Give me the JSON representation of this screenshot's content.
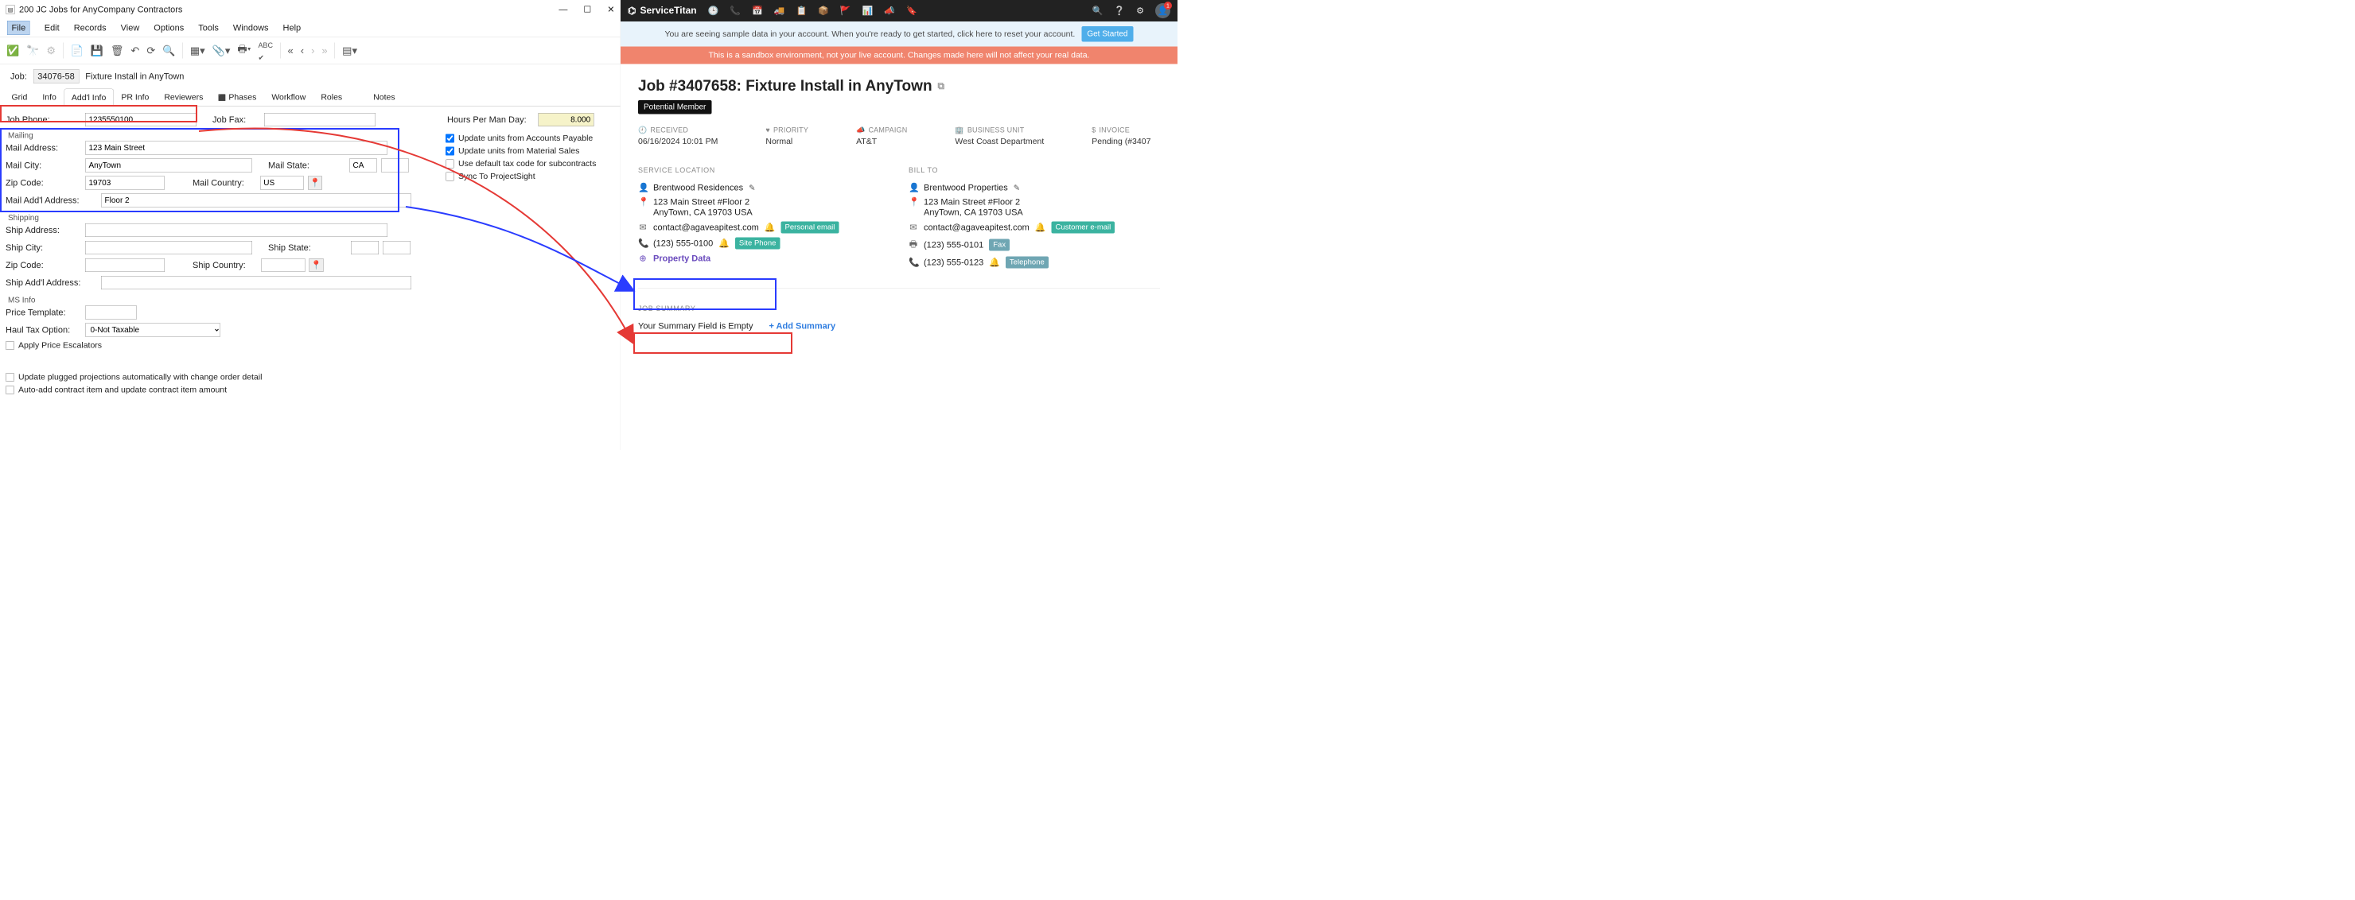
{
  "left": {
    "title": "200 JC Jobs for AnyCompany Contractors",
    "menu": [
      "File",
      "Edit",
      "Records",
      "View",
      "Options",
      "Tools",
      "Windows",
      "Help"
    ],
    "job_label": "Job:",
    "job_id": "34076-58",
    "job_desc": "Fixture Install in AnyTown",
    "tabs": [
      "Grid",
      "Info",
      "Add'l Info",
      "PR Info",
      "Reviewers",
      "Phases",
      "Workflow",
      "Roles",
      "Notes"
    ],
    "fields": {
      "job_phone_label": "Job Phone:",
      "job_phone": "1235550100",
      "job_fax_label": "Job Fax:",
      "job_fax": "",
      "hours_label": "Hours Per Man Day:",
      "hours": "8.000",
      "mailing_header": "Mailing",
      "mail_address_label": "Mail Address:",
      "mail_address": "123 Main Street",
      "mail_city_label": "Mail City:",
      "mail_city": "AnyTown",
      "mail_state_label": "Mail State:",
      "mail_state": "CA",
      "zip_label": "Zip Code:",
      "zip": "19703",
      "mail_country_label": "Mail Country:",
      "mail_country": "US",
      "mail_addl_label": "Mail Add'l Address:",
      "mail_addl": "Floor 2",
      "shipping_header": "Shipping",
      "ship_address_label": "Ship Address:",
      "ship_city_label": "Ship City:",
      "ship_state_label": "Ship State:",
      "ship_zip_label": "Zip Code:",
      "ship_country_label": "Ship Country:",
      "ship_addl_label": "Ship Add'l Address:",
      "ms_header": "MS Info",
      "price_template_label": "Price Template:",
      "haul_tax_label": "Haul Tax Option:",
      "haul_tax_value": "0-Not Taxable",
      "chk_escalators": "Apply Price Escalators",
      "chk_update_proj": "Update plugged projections automatically with change order detail",
      "chk_autoadd": "Auto-add contract item and update contract item amount",
      "chk_units_ap": "Update units from Accounts Payable",
      "chk_units_ms": "Update units from Material Sales",
      "chk_default_tax": "Use default tax code for subcontracts",
      "chk_sync": "Sync To ProjectSight"
    }
  },
  "right": {
    "brand": "ServiceTitan",
    "banner1": "You are seeing sample data in your account. When you're ready to get started, click here to reset your account.",
    "banner1_btn": "Get Started",
    "banner2": "This is a sandbox environment, not your live account. Changes made here will not affect your real data.",
    "title": "Job #3407658: Fixture Install in AnyTown",
    "badge": "Potential Member",
    "meta": {
      "received_h": "RECEIVED",
      "received": "06/16/2024 10:01 PM",
      "priority_h": "PRIORITY",
      "priority": "Normal",
      "campaign_h": "CAMPAIGN",
      "campaign": "AT&T",
      "bu_h": "BUSINESS UNIT",
      "bu": "West Coast Department",
      "invoice_h": "INVOICE",
      "invoice": "Pending (#3407"
    },
    "service_loc_h": "SERVICE LOCATION",
    "bill_to_h": "BILL TO",
    "svc": {
      "name": "Brentwood Residences",
      "addr1": "123 Main Street #Floor 2",
      "addr2": "AnyTown, CA 19703 USA",
      "email": "contact@agaveapitest.com",
      "email_tag": "Personal email",
      "phone": "(123) 555-0100",
      "phone_tag": "Site Phone",
      "prop": "Property Data"
    },
    "bill": {
      "name": "Brentwood Properties",
      "addr1": "123 Main Street #Floor 2",
      "addr2": "AnyTown, CA 19703 USA",
      "email": "contact@agaveapitest.com",
      "email_tag": "Customer e-mail",
      "fax": "(123) 555-0101",
      "fax_tag": "Fax",
      "phone": "(123) 555-0123",
      "phone_tag": "Telephone"
    },
    "summary_h": "JOB SUMMARY",
    "summary_empty": "Your Summary Field is Empty",
    "add_summary": "+ Add Summary"
  }
}
